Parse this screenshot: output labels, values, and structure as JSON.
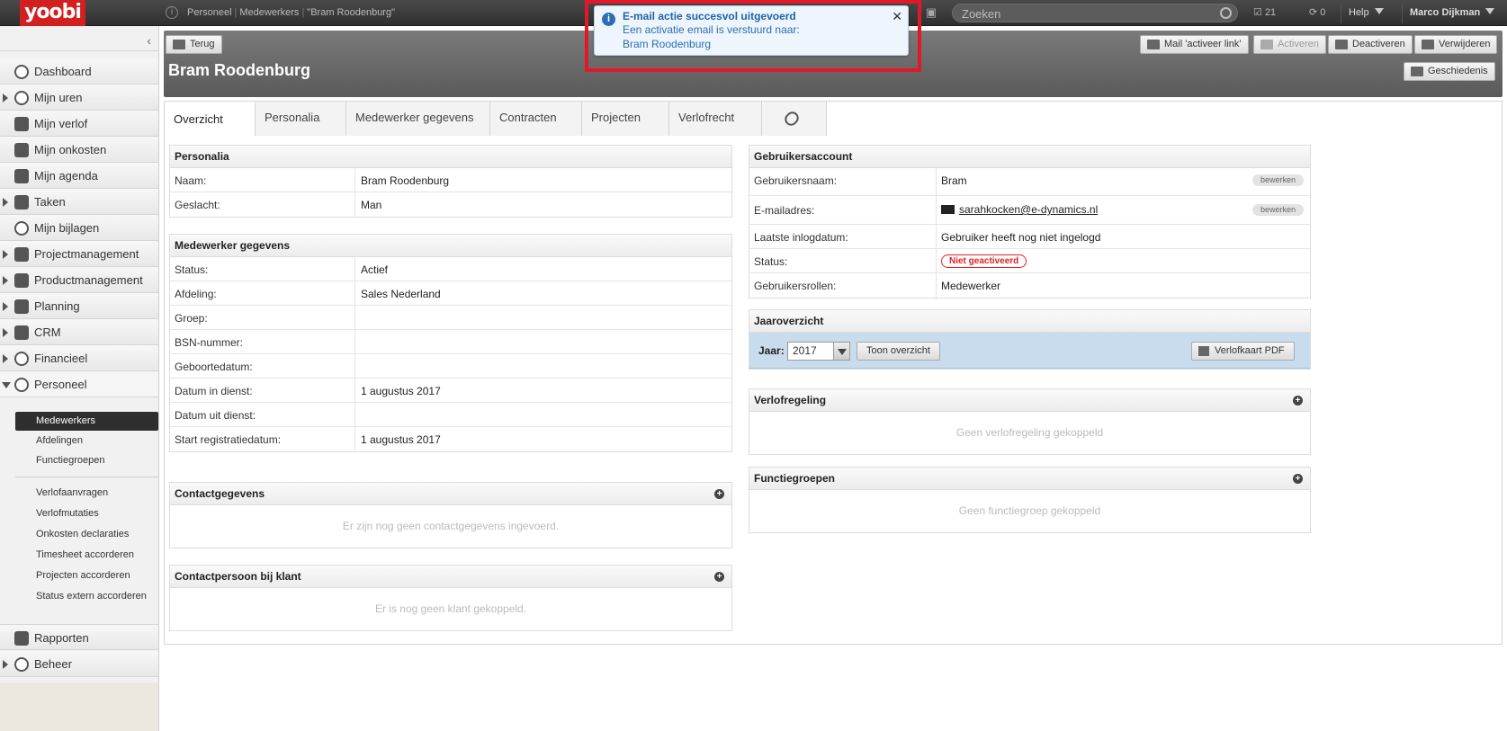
{
  "topbar": {
    "logo": "yoobi",
    "breadcrumb": [
      "Personeel",
      "Medewerkers",
      "\"Bram Roodenburg\""
    ],
    "search_placeholder": "Zoeken",
    "tasks_count": "21",
    "sync_count": "0",
    "help_label": "Help",
    "user_name": "Marco Dijkman"
  },
  "toast": {
    "title": "E-mail actie succesvol uitgevoerd",
    "line1": "Een activatie email is verstuurd naar:",
    "line2": "Bram Roodenburg",
    "close": "✕"
  },
  "sidebar": {
    "items": [
      {
        "label": "Dashboard"
      },
      {
        "label": "Mijn uren"
      },
      {
        "label": "Mijn verlof"
      },
      {
        "label": "Mijn onkosten"
      },
      {
        "label": "Mijn agenda"
      },
      {
        "label": "Taken"
      },
      {
        "label": "Mijn bijlagen"
      },
      {
        "label": "Projectmanagement"
      },
      {
        "label": "Productmanagement"
      },
      {
        "label": "Planning"
      },
      {
        "label": "CRM"
      },
      {
        "label": "Financieel"
      },
      {
        "label": "Personeel"
      }
    ],
    "personeel_sub": [
      {
        "label": "Medewerkers"
      },
      {
        "label": "Afdelingen"
      },
      {
        "label": "Functiegroepen"
      },
      {
        "label": "Verlofaanvragen"
      },
      {
        "label": "Verlofmutaties"
      },
      {
        "label": "Onkosten declaraties"
      },
      {
        "label": "Timesheet accorderen"
      },
      {
        "label": "Projecten accorderen"
      },
      {
        "label": "Status extern accorderen"
      }
    ],
    "bottom_items": [
      {
        "label": "Rapporten"
      },
      {
        "label": "Beheer"
      }
    ]
  },
  "header": {
    "back_label": "Terug",
    "title": "Bram Roodenburg",
    "actions": {
      "mail": "Mail 'activeer link'",
      "activate": "Activeren",
      "deactivate": "Deactiveren",
      "delete": "Verwijderen",
      "history": "Geschiedenis"
    }
  },
  "tabs": [
    {
      "label": "Overzicht"
    },
    {
      "label": "Personalia"
    },
    {
      "label": "Medewerker gegevens"
    },
    {
      "label": "Contracten"
    },
    {
      "label": "Projecten"
    },
    {
      "label": "Verlofrecht"
    }
  ],
  "personalia": {
    "title": "Personalia",
    "rows": [
      {
        "label": "Naam:",
        "value": "Bram Roodenburg"
      },
      {
        "label": "Geslacht:",
        "value": "Man"
      }
    ]
  },
  "medewerker": {
    "title": "Medewerker gegevens",
    "rows": [
      {
        "label": "Status:",
        "value": "Actief"
      },
      {
        "label": "Afdeling:",
        "value": "Sales Nederland"
      },
      {
        "label": "Groep:",
        "value": ""
      },
      {
        "label": "BSN-nummer:",
        "value": ""
      },
      {
        "label": "Geboortedatum:",
        "value": ""
      },
      {
        "label": "Datum in dienst:",
        "value": "1 augustus 2017"
      },
      {
        "label": "Datum uit dienst:",
        "value": ""
      },
      {
        "label": "Start registratiedatum:",
        "value": "1 augustus 2017"
      }
    ]
  },
  "contact": {
    "title": "Contactgegevens",
    "empty": "Er zijn nog geen contactgegevens ingevoerd."
  },
  "contactpersoon": {
    "title": "Contactpersoon bij klant",
    "empty": "Er is nog geen klant gekoppeld."
  },
  "account": {
    "title": "Gebruikersaccount",
    "edit_label": "bewerken",
    "rows": [
      {
        "label": "Gebruikersnaam:",
        "value": "Bram"
      },
      {
        "label": "E-mailadres:",
        "value": "sarahkocken@e-dynamics.nl"
      },
      {
        "label": "Laatste inlogdatum:",
        "value": "Gebruiker heeft nog niet ingelogd"
      },
      {
        "label": "Status:",
        "value": "Niet geactiveerd"
      },
      {
        "label": "Gebruikersrollen:",
        "value": "Medewerker"
      }
    ],
    "status_color": "#dd2222"
  },
  "jaaroverzicht": {
    "title": "Jaaroverzicht",
    "year_label": "Jaar:",
    "year_value": "2017",
    "show_button": "Toon overzicht",
    "pdf_button": "Verlofkaart PDF"
  },
  "verlofregeling": {
    "title": "Verlofregeling",
    "empty": "Geen verlofregeling gekoppeld"
  },
  "functiegroepen": {
    "title": "Functiegroepen",
    "empty": "Geen functiegroep gekoppeld"
  },
  "colors": {
    "brand": "#d21f1f",
    "highlight": "#e0192a",
    "info": "#2b6fb3"
  }
}
